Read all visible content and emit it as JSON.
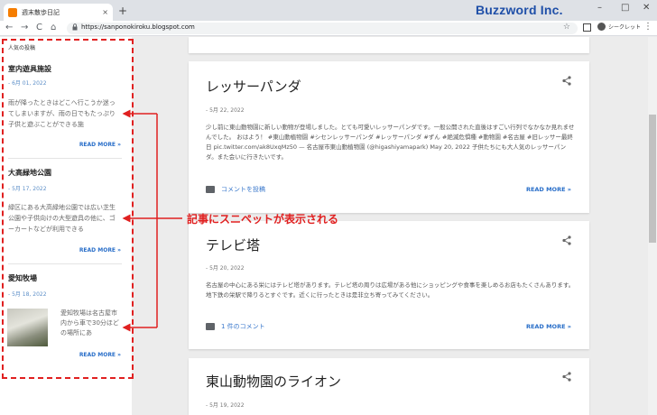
{
  "browser": {
    "tab_title": "週末散歩日記",
    "tab_close": "×",
    "new_tab": "+",
    "brand": "Buzzword Inc.",
    "window_controls": [
      "–",
      "□",
      "✕"
    ],
    "nav": {
      "back": "←",
      "forward": "→",
      "reload": "C",
      "home": "⌂"
    },
    "url": "https://sanponokiroku.blogspot.com",
    "incognito_label": "シークレット",
    "menu": "⋮",
    "bookmark": "☆",
    "lock": "🔒"
  },
  "sidebar": {
    "heading": "人気の投稿",
    "items": [
      {
        "title": "室内遊具施設",
        "date": "- 6月 01, 2022",
        "snippet": "雨が降ったときはどこへ行こうか迷ってしまいますが、雨の日でもたっぷり子供と遊ぶことができる施",
        "more": "READ MORE »"
      },
      {
        "title": "大高緑地公園",
        "date": "- 5月 17, 2022",
        "snippet": "緑区にある大高緑地公園では広い芝生公園や子供向けの大型遊具の他に、ゴーカートなどが利用できる",
        "more": "READ MORE »"
      },
      {
        "title": "愛知牧場",
        "date": "- 5月 18, 2022",
        "snippet": "愛知牧場は名古屋市内から車で30分ほどの場所にあ",
        "more": "READ MORE »"
      }
    ]
  },
  "posts": [
    {
      "title": "レッサーパンダ",
      "date": "- 5月 22, 2022",
      "body": "少し前に東山動物園に新しい動物が登場しました。とても可愛いレッサーパンダです。一般公開された直後はすごい行列でなかなか見れませんでした。 おはよう！ #東山動植物園 #シセンレッサーパンダ #レッサーパンダ #ずん #絶滅危惧種 #動物園 #名古屋 #旧レッサー最終日 pic.twitter.com/ak8UxqMz50 — 名古屋市東山動植物園 (@higashiyamapark) May 20, 2022 子供たちにも大人気のレッサーパンダ。また会いに行きたいです。",
      "comment": "コメントを投稿",
      "more": "READ MORE »"
    },
    {
      "title": "テレビ塔",
      "date": "- 5月 20, 2022",
      "body": "名古屋の中心にある栄にはテレビ塔があります。テレビ塔の周りは広場がある他にショッピングや食事を楽しめるお店もたくさんあります。地下鉄の栄駅で降りるとすぐです。近くに行ったときは是非立ち寄ってみてください。",
      "comment": "1 件のコメント",
      "more": "READ MORE »"
    },
    {
      "title": "東山動物園のライオン",
      "date": "- 5月 19, 2022"
    }
  ],
  "share_glyph": "<",
  "annotation": "記事にスニペットが表示される",
  "colors": {
    "annotation_red": "#e02020",
    "link_blue": "#2a6fc9",
    "brand_blue": "#1f4fa8"
  }
}
